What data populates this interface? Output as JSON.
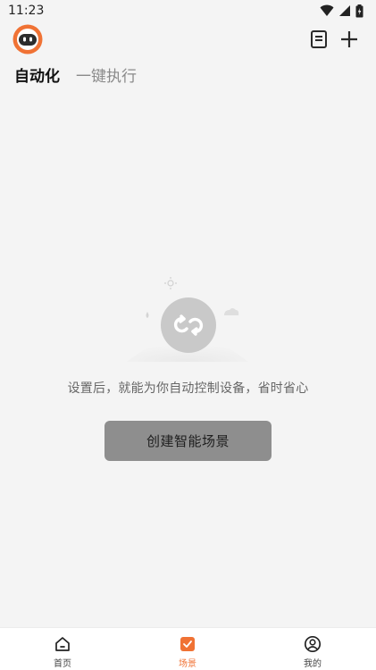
{
  "status_bar": {
    "time": "11:23"
  },
  "header": {
    "avatar_icon": "robot-avatar-icon",
    "log_icon": "document-list-icon",
    "add_icon": "plus-icon"
  },
  "tabs": {
    "items": [
      {
        "label": "自动化",
        "active": true
      },
      {
        "label": "一键执行",
        "active": false
      }
    ]
  },
  "empty_state": {
    "icon": "loop-sync-icon",
    "message": "设置后，就能为你自动控制设备，省时省心",
    "button_label": "创建智能场景"
  },
  "bottom_nav": {
    "items": [
      {
        "label": "首页",
        "icon": "home-icon",
        "active": false
      },
      {
        "label": "场景",
        "icon": "scene-check-icon",
        "active": true
      },
      {
        "label": "我的",
        "icon": "profile-icon",
        "active": false
      }
    ]
  },
  "colors": {
    "accent": "#f07234",
    "background": "#f4f4f4",
    "button": "#8e8e8e"
  }
}
